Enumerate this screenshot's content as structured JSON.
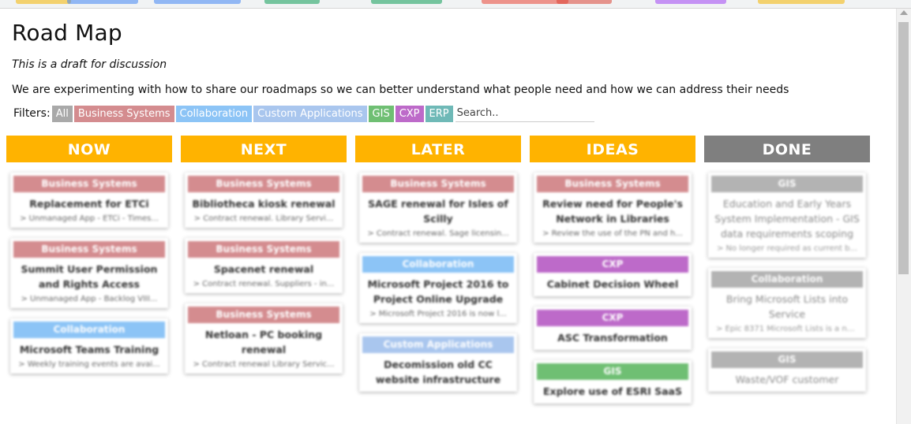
{
  "colors": {
    "Business Systems": "#d48c8f",
    "Collaboration": "#8cc4f6",
    "Custom Applications": "#a9c6ee",
    "GIS": "#6fbf73",
    "CXP": "#bd6ac9",
    "ERP": "#6fb9b7",
    "All": "#a9a9a9",
    "column_active": "#ffb300",
    "column_done": "#7f7f7f"
  },
  "page": {
    "title": "Road Map",
    "draft_note": "This is a draft for discussion",
    "intro": "We are experimenting with how to share our roadmaps so we can better understand what people need and how we can address their needs"
  },
  "filters": {
    "label": "Filters:",
    "chips": [
      "All",
      "Business Systems",
      "Collaboration",
      "Custom Applications",
      "GIS",
      "CXP",
      "ERP"
    ],
    "search_placeholder": "Search.."
  },
  "columns": [
    {
      "title": "NOW",
      "cards": [
        {
          "category": "Business Systems",
          "title": "Replacement for ETCi",
          "desc": "> Unmanaged App - ETCi - Times..."
        },
        {
          "category": "Business Systems",
          "title": "Summit User Permission and Rights Access",
          "desc": "> Unmanaged App - Backlog VIII..."
        },
        {
          "category": "Collaboration",
          "title": "Microsoft Teams Training",
          "desc": "> Weekly training events are avai..."
        }
      ]
    },
    {
      "title": "NEXT",
      "cards": [
        {
          "category": "Business Systems",
          "title": "Bibliotheca kiosk renewal",
          "desc": "> Contract renewal. Library Servi..."
        },
        {
          "category": "Business Systems",
          "title": "Spacenet renewal",
          "desc": "> Contract renewal. Suppliers - in..."
        },
        {
          "category": "Business Systems",
          "title": "Netloan - PC booking renewal",
          "desc": "> Contract renewal Library Servic..."
        }
      ]
    },
    {
      "title": "LATER",
      "cards": [
        {
          "category": "Business Systems",
          "title": "SAGE renewal for Isles of Scilly",
          "desc": "> Contract renewal. Sage licensin..."
        },
        {
          "category": "Collaboration",
          "title": "Microsoft Project 2016 to Project Online Upgrade",
          "desc": "> Microsoft Project 2016 is now l..."
        },
        {
          "category": "Custom Applications",
          "title": "Decomission old CC website infrastructure",
          "desc": ""
        }
      ]
    },
    {
      "title": "IDEAS",
      "cards": [
        {
          "category": "Business Systems",
          "title": "Review need for People's Network in Libraries",
          "desc": "> Review the use of the PN and h..."
        },
        {
          "category": "CXP",
          "title": "Cabinet Decision Wheel",
          "desc": ""
        },
        {
          "category": "CXP",
          "title": "ASC Transformation",
          "desc": ""
        },
        {
          "category": "GIS",
          "title": "Explore use of ESRI SaaS",
          "desc": ""
        }
      ]
    },
    {
      "title": "DONE",
      "cards": [
        {
          "category": "GIS",
          "title": "Education and Early Years System Implementation - GIS data requirements scoping",
          "desc": "> No longer required as current b..."
        },
        {
          "category": "Collaboration",
          "title": "Bring Microsoft Lists into Service",
          "desc": "> Epic 8371 Microsoft Lists is a ne..."
        },
        {
          "category": "GIS",
          "title": "Waste/VOF customer",
          "desc": ""
        }
      ]
    }
  ]
}
